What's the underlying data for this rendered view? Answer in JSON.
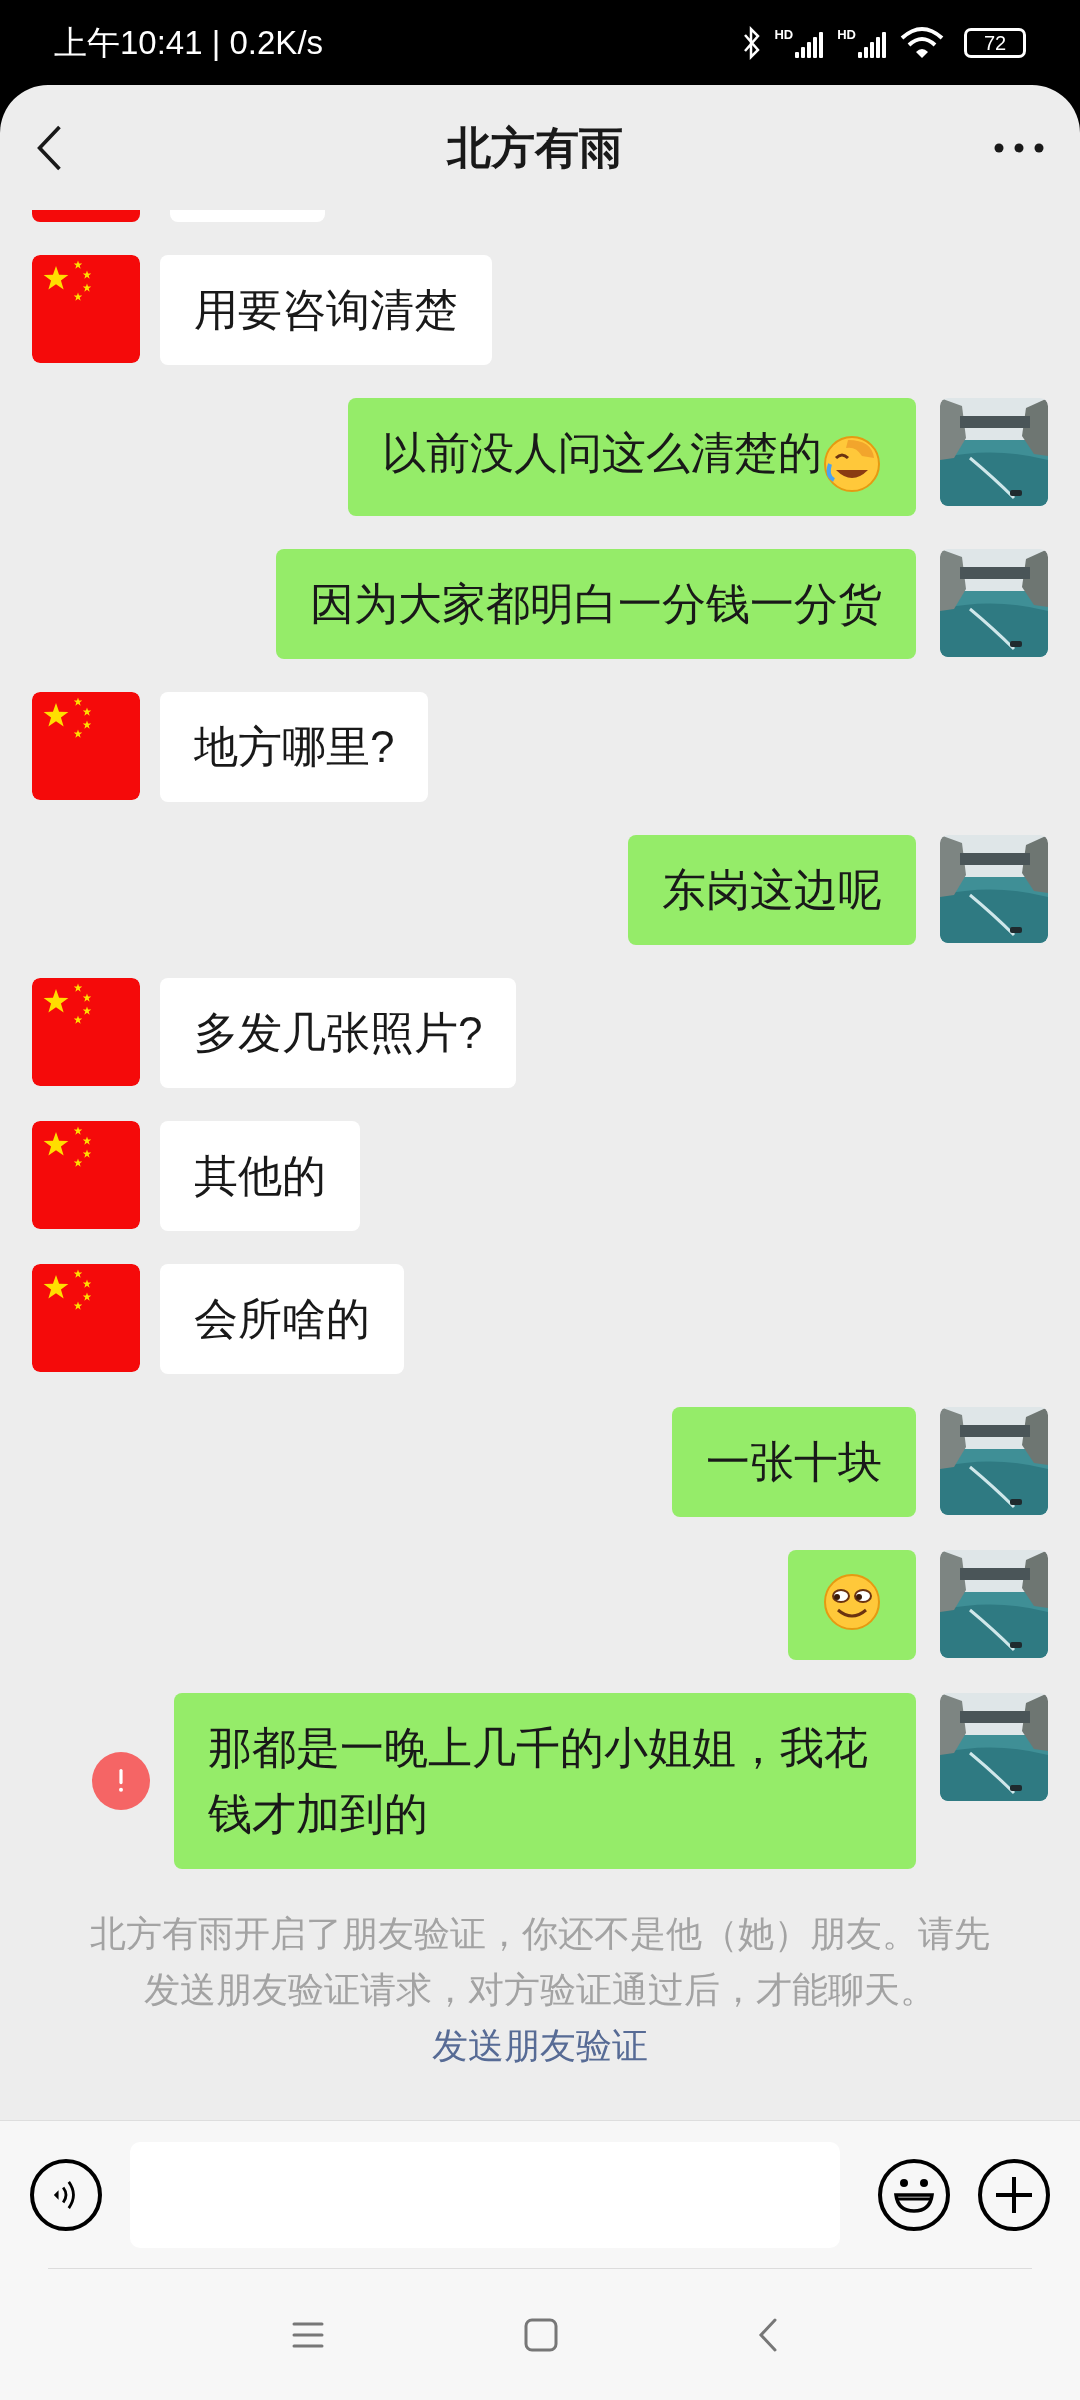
{
  "status_bar": {
    "time": "上午10:41 | 0.2K/s",
    "signals": [
      {
        "label": "HD"
      },
      {
        "label": "HD"
      }
    ],
    "battery": "72"
  },
  "header": {
    "title": "北方有雨"
  },
  "messages": [
    {
      "kind": "clipped"
    },
    {
      "kind": "received",
      "parts": [
        {
          "kind": "text",
          "text": "用要咨询清楚"
        }
      ],
      "failed": false
    },
    {
      "kind": "sent",
      "parts": [
        {
          "kind": "text",
          "text": "以前没人问这么清楚的"
        },
        {
          "kind": "laughing"
        }
      ],
      "failed": false
    },
    {
      "kind": "sent",
      "parts": [
        {
          "kind": "text",
          "text": "因为大家都明白一分钱一分货"
        }
      ],
      "failed": false
    },
    {
      "kind": "received",
      "parts": [
        {
          "kind": "text",
          "text": "地方哪里?"
        }
      ],
      "failed": false
    },
    {
      "kind": "sent",
      "parts": [
        {
          "kind": "text",
          "text": "东岗这边呢"
        }
      ],
      "failed": false
    },
    {
      "kind": "received",
      "parts": [
        {
          "kind": "text",
          "text": "多发几张照片?"
        }
      ],
      "failed": false
    },
    {
      "kind": "received",
      "parts": [
        {
          "kind": "text",
          "text": "其他的"
        }
      ],
      "failed": false
    },
    {
      "kind": "received",
      "parts": [
        {
          "kind": "text",
          "text": "会所啥的"
        }
      ],
      "failed": false
    },
    {
      "kind": "sent",
      "parts": [
        {
          "kind": "text",
          "text": "一张十块"
        }
      ],
      "failed": false
    },
    {
      "kind": "sent",
      "parts": [
        {
          "kind": "grinning"
        }
      ],
      "failed": false
    },
    {
      "kind": "sent",
      "parts": [
        {
          "kind": "text",
          "text": "那都是一晚上几千的小姐姐，我花钱才加到的"
        }
      ],
      "failed": true
    }
  ],
  "system_notice": {
    "text": "北方有雨开启了朋友验证，你还不是他（她）朋友。请先发送朋友验证请求，对方验证通过后，才能聊天。",
    "link": "发送朋友验证"
  }
}
